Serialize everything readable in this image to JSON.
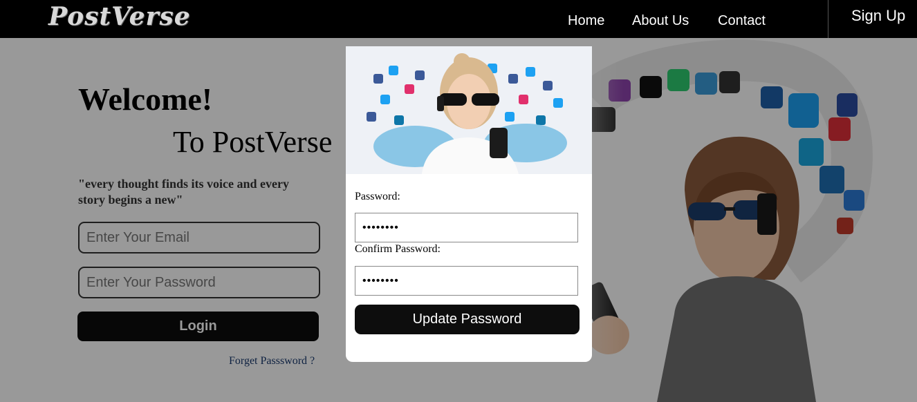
{
  "navbar": {
    "logo": "PostVerse",
    "links": [
      "Home",
      "About Us",
      "Contact"
    ],
    "signup": "Sign Up"
  },
  "login": {
    "welcome": "Welcome!",
    "subtitle": "To PostVerse",
    "tagline": "\"every thought finds its voice and every story begins a new\"",
    "email_placeholder": "Enter Your Email",
    "password_placeholder": "Enter Your Password",
    "login_label": "Login",
    "forgot_label": "Forget Passsword ?"
  },
  "modal": {
    "password_label": "Password:",
    "password_value": "password",
    "confirm_label": "Confirm Password:",
    "confirm_value": "password",
    "update_label": "Update Password"
  },
  "colors": {
    "navbar_bg": "#000000",
    "button_bg": "#0d0d0d",
    "overlay": "rgba(0,0,0,0.40)"
  }
}
